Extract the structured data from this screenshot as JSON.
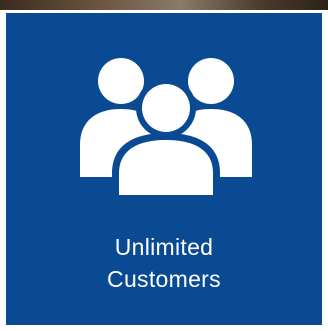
{
  "tile": {
    "icon": "users-group-icon",
    "caption_line1": "Unlimited",
    "caption_line2": "Customers",
    "background_color": "#0a4a93",
    "text_color": "#ffffff"
  }
}
